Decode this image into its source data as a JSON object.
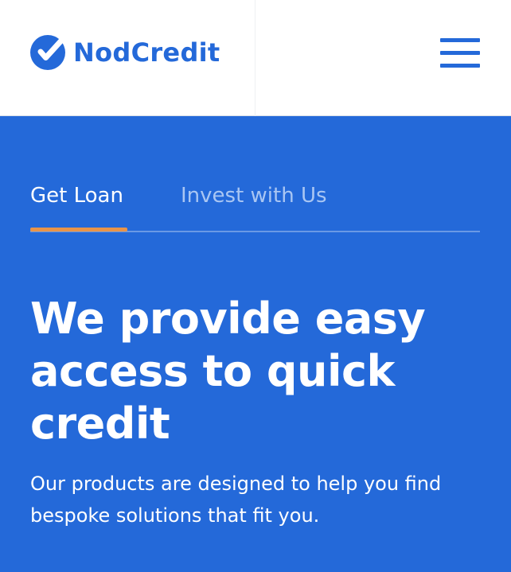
{
  "header": {
    "brand_name": "NodCredit",
    "logo_icon": "checkmark-circle-icon",
    "menu_icon": "hamburger-menu-icon"
  },
  "tabs": [
    {
      "label": "Get Loan",
      "active": true
    },
    {
      "label": "Invest with Us",
      "active": false
    }
  ],
  "hero": {
    "title": "We provide easy access to quick credit",
    "subtitle": "Our products are designed to help you find bespoke solutions that fit you."
  },
  "colors": {
    "brand_blue": "#2469d9",
    "header_bg": "#ffffff",
    "tab_indicator": "#e8944a",
    "inactive_tab_text": "#a9c6f3"
  }
}
